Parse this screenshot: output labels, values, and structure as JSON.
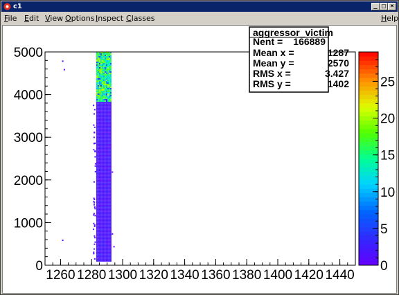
{
  "window": {
    "title": "c1",
    "controls": {
      "minimize": "_",
      "maximize": "□",
      "close": "×"
    }
  },
  "menu": {
    "items": [
      "File",
      "Edit",
      "View",
      "Options",
      "Inspect",
      "Classes"
    ],
    "help": "Help"
  },
  "stats_box": {
    "name": "aggressor_victim",
    "rows": [
      {
        "label": "Nent = ",
        "value": "166889"
      },
      {
        "label": "Mean x = ",
        "value": "1287"
      },
      {
        "label": "Mean y = ",
        "value": "2570"
      },
      {
        "label": "RMS x = ",
        "value": "3.427"
      },
      {
        "label": "RMS y = ",
        "value": "1402"
      }
    ]
  },
  "chart_data": {
    "type": "heatmap",
    "x_ticks": [
      "1260",
      "1280",
      "1300",
      "1320",
      "1340",
      "1360",
      "1380",
      "1400",
      "1420",
      "1440"
    ],
    "y_ticks": [
      "0",
      "1000",
      "2000",
      "3000",
      "4000",
      "5000"
    ],
    "xlim": [
      1250,
      1450
    ],
    "ylim": [
      0,
      5000
    ],
    "z_ticks": [
      "0",
      "5",
      "10",
      "15",
      "20",
      "25"
    ],
    "zlim": [
      0,
      29
    ],
    "band": {
      "x_from": 1283,
      "x_to": 1292
    },
    "regions": [
      {
        "y_from": 100,
        "y_to": 3850,
        "typical_count": 2
      },
      {
        "y_from": 3850,
        "y_to": 5000,
        "typical_count": 15
      }
    ],
    "outliers": [
      {
        "x": 1261,
        "y": 4800
      },
      {
        "x": 1262,
        "y": 4600
      },
      {
        "x": 1261,
        "y": 600
      },
      {
        "x": 1293,
        "y": 2200
      },
      {
        "x": 1293,
        "y": 750
      },
      {
        "x": 1294,
        "y": 450
      },
      {
        "x": 1281,
        "y": 3300
      }
    ],
    "colors": {
      "palette_top": "#ff0000",
      "palette_bottom": "#6600ff"
    }
  }
}
